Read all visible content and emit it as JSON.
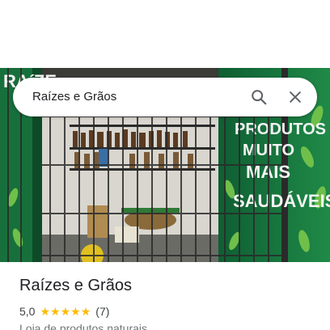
{
  "search": {
    "query": "Raízes e Grãos",
    "search_icon": "search-icon",
    "close_icon": "close-icon"
  },
  "photo": {
    "wall_text": [
      "PRODUTOS",
      "MUITO",
      "MAIS",
      "SAUDÁVEIS!"
    ],
    "top_wall_text": "RAíZE"
  },
  "place": {
    "title": "Raízes e Grãos",
    "rating": "5,0",
    "stars": 5,
    "review_count": "(7)",
    "category": "Loja de produtos naturais"
  },
  "colors": {
    "star": "#fbbc04",
    "wall_green": "#1f7a3e"
  }
}
